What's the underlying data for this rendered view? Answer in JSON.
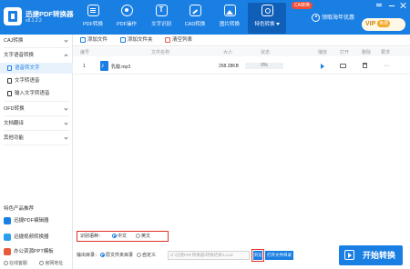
{
  "header": {
    "app_name": "迅捷PDF转换器",
    "app_version": "v8.1.2.2",
    "tools": [
      {
        "label": "PDF转换",
        "icon": "pdf-convert-icon"
      },
      {
        "label": "PDF操作",
        "icon": "pdf-operate-icon"
      },
      {
        "label": "文字识别",
        "icon": "ocr-icon"
      },
      {
        "label": "CAD转换",
        "icon": "cad-icon"
      },
      {
        "label": "图片转换",
        "icon": "image-icon"
      },
      {
        "label": "特色转换",
        "icon": "feature-icon"
      }
    ],
    "ca_badge": "CA转换",
    "user_label": "领取海年优惠",
    "vip_label": "VIP",
    "vip_tag": "免费"
  },
  "sidebar": {
    "groups": [
      {
        "label": "CAJ转换",
        "expanded": false
      },
      {
        "label": "文字语音转换",
        "expanded": true,
        "items": [
          {
            "label": "语音转文字",
            "active": true
          },
          {
            "label": "文字转语音",
            "active": false
          },
          {
            "label": "输入文字转语音",
            "active": false
          }
        ]
      },
      {
        "label": "OFD转换",
        "expanded": false
      },
      {
        "label": "文档翻译",
        "expanded": false
      },
      {
        "label": "其他功能",
        "expanded": false
      }
    ],
    "recommend_title": "特色产品推荐",
    "products": [
      {
        "label": "迅捷PDF编辑器",
        "color": "#1a7fe3"
      },
      {
        "label": "迅捷视频转换器",
        "color": "#2a9ff0"
      },
      {
        "label": "办公资源PPT模板",
        "color": "#e85a3c"
      }
    ],
    "bottom_links": [
      "在线客服",
      "官网地址"
    ]
  },
  "toolbar": {
    "add_file": "添加文件",
    "add_folder": "添加文件夹",
    "clear_list": "清空列表"
  },
  "table": {
    "headers": [
      "编号",
      "文件名称",
      "大小",
      "状态",
      "播放",
      "打开",
      "删除",
      "要求"
    ],
    "rows": [
      {
        "index": "1",
        "name": "乳酸.mp3",
        "size": "258.28KB",
        "progress": "0%",
        "progress_value": 0
      }
    ]
  },
  "language": {
    "label": "识别语种：",
    "options": [
      {
        "label": "中文",
        "selected": true
      },
      {
        "label": "英文",
        "selected": false
      }
    ]
  },
  "output": {
    "label": "输出目录：",
    "options": [
      {
        "label": "原文件夹目录",
        "selected": true
      },
      {
        "label": "自定义",
        "selected": false
      }
    ],
    "path_placeholder": "D:\\迅捷PDF转换器\\转换结果\\Local",
    "browse_label": "浏览",
    "open_folder_label": "打开文件目录"
  },
  "start_button": "开始转换",
  "colors": {
    "accent": "#1a7fe3",
    "highlight": "#e0332a"
  }
}
